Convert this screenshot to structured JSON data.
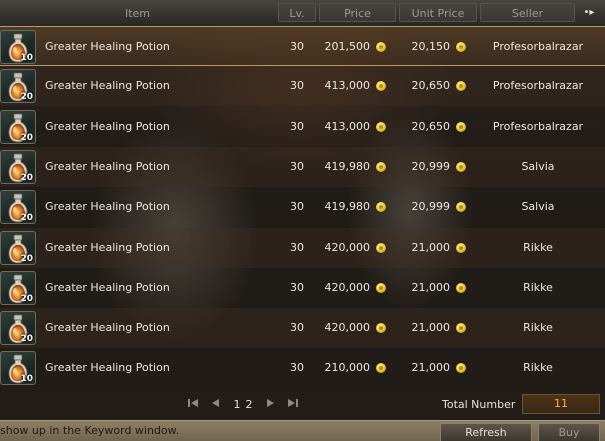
{
  "header": {
    "item": "Item",
    "level": "Lv.",
    "price": "Price",
    "unit_price": "Unit Price",
    "seller": "Seller",
    "sort_glyph": "•▸"
  },
  "rows": [
    {
      "qty": "10",
      "name": "Greater Healing Potion",
      "level": "30",
      "price": "201,500",
      "unit_price": "20,150",
      "seller": "Profesorbalrazar"
    },
    {
      "qty": "20",
      "name": "Greater Healing Potion",
      "level": "30",
      "price": "413,000",
      "unit_price": "20,650",
      "seller": "Profesorbalrazar"
    },
    {
      "qty": "20",
      "name": "Greater Healing Potion",
      "level": "30",
      "price": "413,000",
      "unit_price": "20,650",
      "seller": "Profesorbalrazar"
    },
    {
      "qty": "20",
      "name": "Greater Healing Potion",
      "level": "30",
      "price": "419,980",
      "unit_price": "20,999",
      "seller": "Salvia"
    },
    {
      "qty": "20",
      "name": "Greater Healing Potion",
      "level": "30",
      "price": "419,980",
      "unit_price": "20,999",
      "seller": "Salvia"
    },
    {
      "qty": "20",
      "name": "Greater Healing Potion",
      "level": "30",
      "price": "420,000",
      "unit_price": "21,000",
      "seller": "Rikke"
    },
    {
      "qty": "20",
      "name": "Greater Healing Potion",
      "level": "30",
      "price": "420,000",
      "unit_price": "21,000",
      "seller": "Rikke"
    },
    {
      "qty": "20",
      "name": "Greater Healing Potion",
      "level": "30",
      "price": "420,000",
      "unit_price": "21,000",
      "seller": "Rikke"
    },
    {
      "qty": "10",
      "name": "Greater Healing Potion",
      "level": "30",
      "price": "210,000",
      "unit_price": "21,000",
      "seller": "Rikke"
    }
  ],
  "pagination": {
    "pages": [
      "1",
      "2"
    ]
  },
  "total": {
    "label": "Total Number",
    "value": "11"
  },
  "status_message": "show up in the Keyword window.",
  "buttons": {
    "refresh": "Refresh",
    "buy": "Buy"
  },
  "icons": {
    "item": "potion-icon",
    "currency": "gold-coin-icon",
    "first": "first-page-icon",
    "prev": "prev-page-icon",
    "next": "next-page-icon",
    "last": "last-page-icon"
  },
  "colors": {
    "accent": "#f2b24a",
    "selected_border": "#b99a60",
    "coin": "#e6c12b"
  }
}
